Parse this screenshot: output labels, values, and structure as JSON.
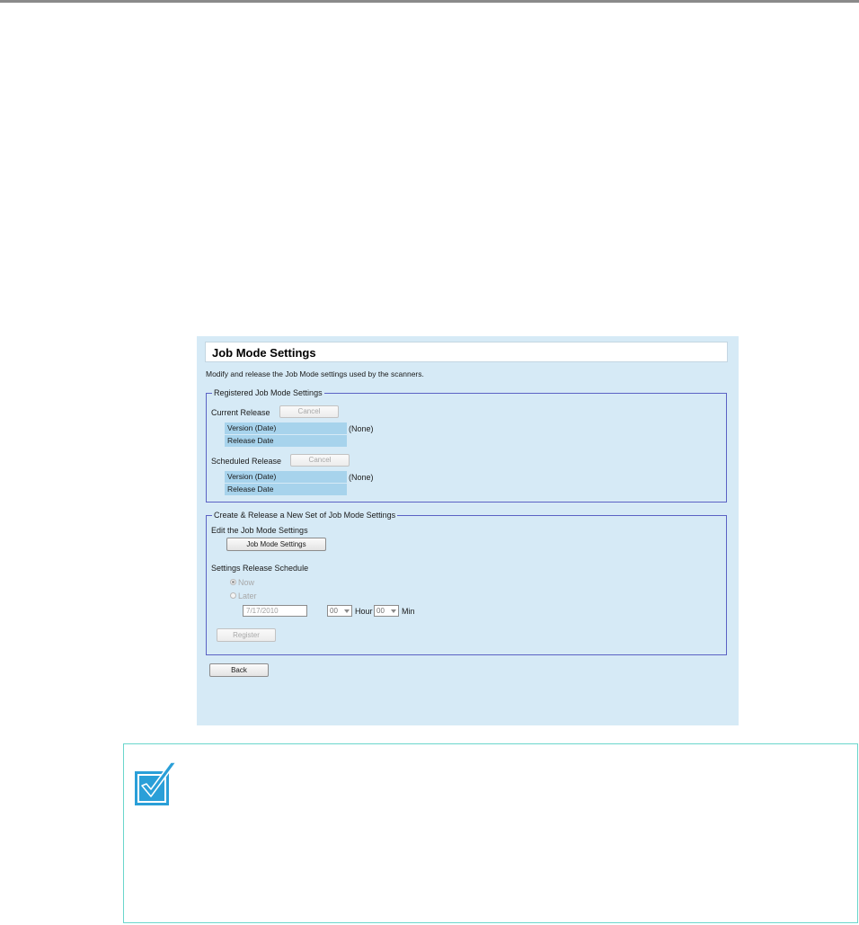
{
  "panel": {
    "title": "Job Mode Settings",
    "description": "Modify and release the Job Mode settings used by the scanners."
  },
  "registered": {
    "legend": "Registered Job Mode Settings",
    "current_label": "Current Release",
    "current_cancel": "Cancel",
    "current_version_label": "Version (Date)",
    "current_version_value": "(None)",
    "current_release_date_label": "Release Date",
    "scheduled_label": "Scheduled Release",
    "scheduled_cancel": "Cancel",
    "scheduled_version_label": "Version (Date)",
    "scheduled_version_value": "(None)",
    "scheduled_release_date_label": "Release Date"
  },
  "create": {
    "legend": "Create & Release a New Set of Job Mode Settings",
    "edit_label": "Edit the Job Mode Settings",
    "edit_button": "Job Mode Settings",
    "schedule_label": "Settings Release Schedule",
    "radio_now": "Now",
    "radio_later": "Later",
    "date_value": "7/17/2010",
    "hour_value": "00",
    "hour_label": "Hour",
    "min_value": "00",
    "min_label": "Min",
    "register_button": "Register"
  },
  "back_button": "Back",
  "note": {
    "icon": "checkmark-icon",
    "border_color": "#6ad6cc",
    "icon_color": "#2a9fd8"
  }
}
